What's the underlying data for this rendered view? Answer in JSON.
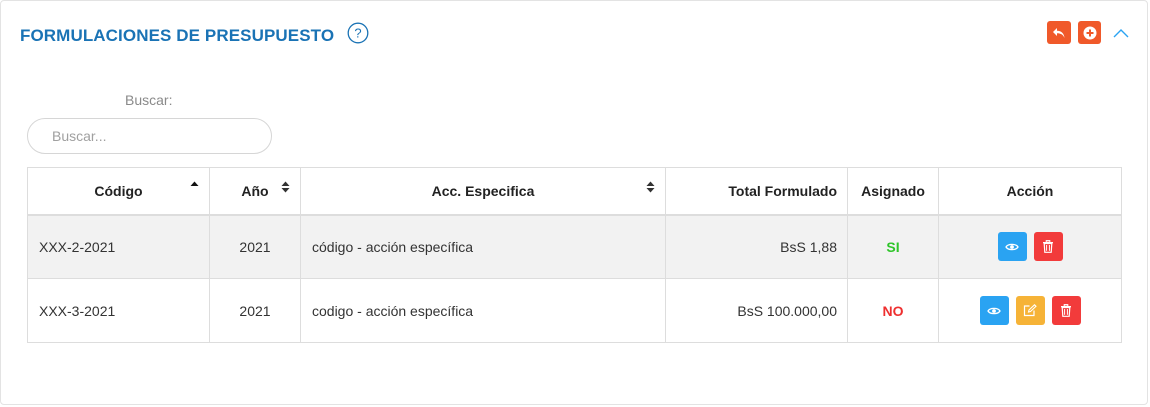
{
  "header": {
    "title": "FORMULACIONES DE PRESUPUESTO",
    "help_icon": "question-circle-icon",
    "back_icon": "reply-icon",
    "add_icon": "plus-circle-icon",
    "collapse_icon": "chevron-up-icon",
    "accent_color": "#f0592a",
    "title_color": "#1a73b5"
  },
  "search": {
    "label": "Buscar:",
    "placeholder": "Buscar...",
    "value": ""
  },
  "table": {
    "columns": [
      {
        "label": "Código",
        "sort": "asc"
      },
      {
        "label": "Año",
        "sort": "both"
      },
      {
        "label": "Acc. Especifica",
        "sort": "both"
      },
      {
        "label": "Total Formulado"
      },
      {
        "label": "Asignado"
      },
      {
        "label": "Acción"
      }
    ],
    "rows": [
      {
        "code": "XXX-2-2021",
        "year": "2021",
        "acc": "código - acción específica",
        "total": "BsS 1,88",
        "assigned": "SI",
        "actions": [
          "view",
          "delete"
        ]
      },
      {
        "code": "XXX-3-2021",
        "year": "2021",
        "acc": "codigo - acción específica",
        "total": "BsS 100.000,00",
        "assigned": "NO",
        "actions": [
          "view",
          "edit",
          "delete"
        ]
      }
    ]
  },
  "colors": {
    "yes": "#2fc52a",
    "no": "#ee2f2f",
    "view_button": "#2aa3f2",
    "edit_button": "#f6b337",
    "delete_button": "#f23b3b"
  }
}
